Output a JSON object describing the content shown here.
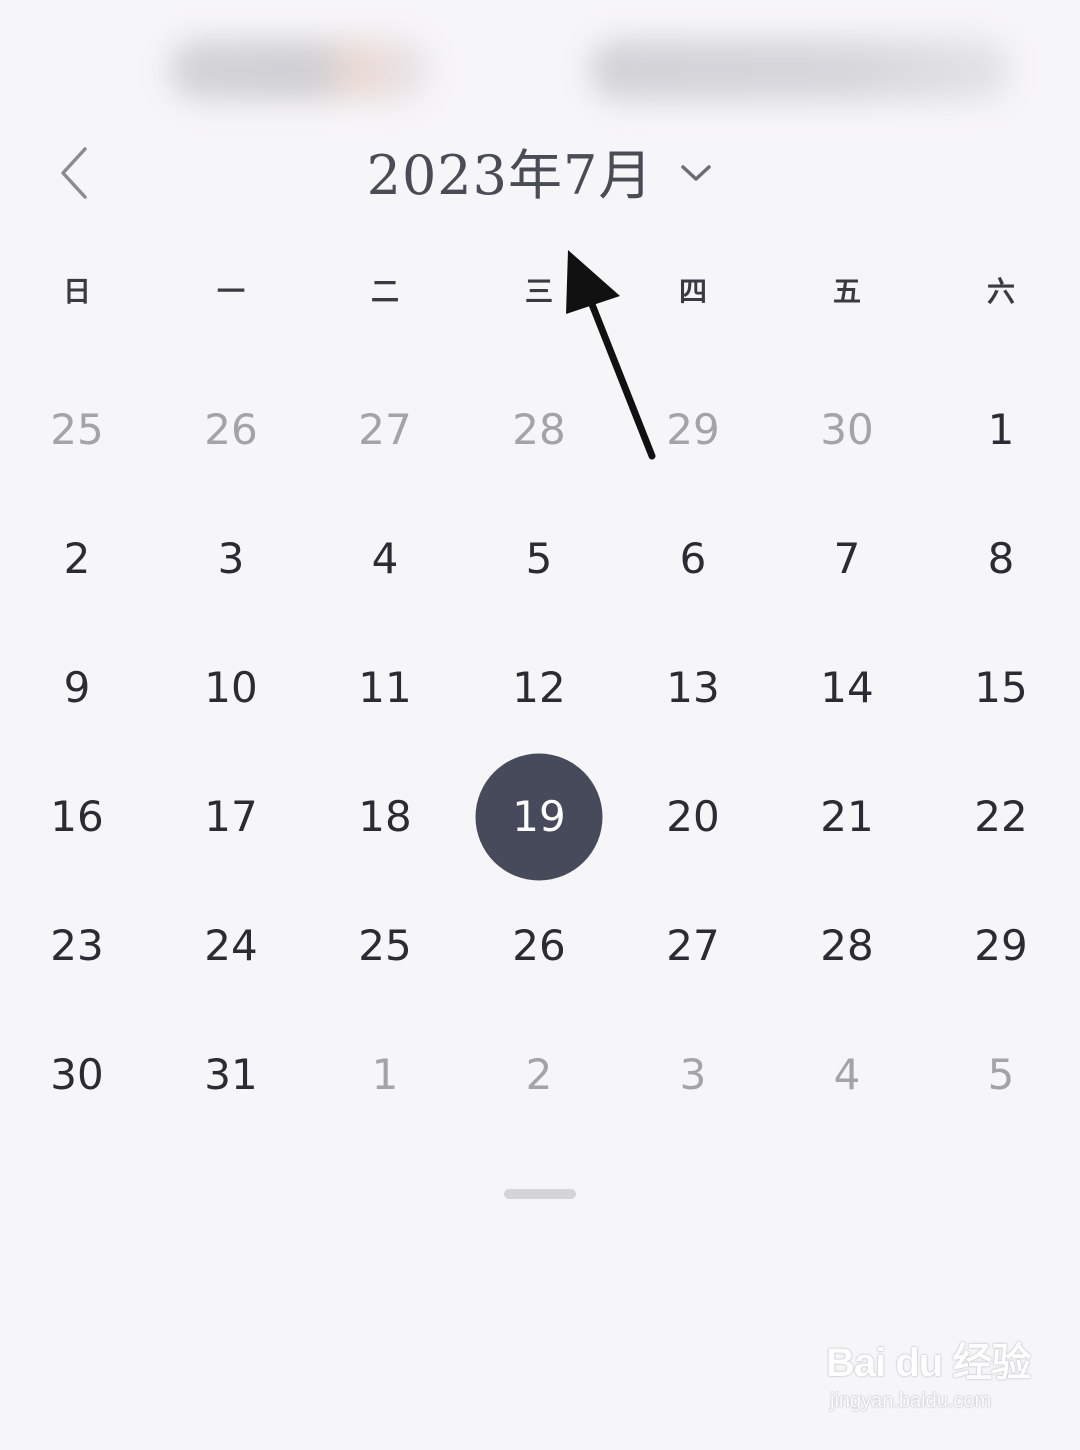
{
  "header": {
    "title": "2023年7月"
  },
  "weekdays": [
    "日",
    "一",
    "二",
    "三",
    "四",
    "五",
    "六"
  ],
  "calendar": {
    "weeks": [
      [
        {
          "d": "25",
          "o": true
        },
        {
          "d": "26",
          "o": true
        },
        {
          "d": "27",
          "o": true
        },
        {
          "d": "28",
          "o": true
        },
        {
          "d": "29",
          "o": true
        },
        {
          "d": "30",
          "o": true
        },
        {
          "d": "1",
          "o": false
        }
      ],
      [
        {
          "d": "2",
          "o": false
        },
        {
          "d": "3",
          "o": false
        },
        {
          "d": "4",
          "o": false
        },
        {
          "d": "5",
          "o": false
        },
        {
          "d": "6",
          "o": false
        },
        {
          "d": "7",
          "o": false
        },
        {
          "d": "8",
          "o": false
        }
      ],
      [
        {
          "d": "9",
          "o": false
        },
        {
          "d": "10",
          "o": false
        },
        {
          "d": "11",
          "o": false
        },
        {
          "d": "12",
          "o": false
        },
        {
          "d": "13",
          "o": false
        },
        {
          "d": "14",
          "o": false
        },
        {
          "d": "15",
          "o": false
        }
      ],
      [
        {
          "d": "16",
          "o": false
        },
        {
          "d": "17",
          "o": false
        },
        {
          "d": "18",
          "o": false
        },
        {
          "d": "19",
          "o": false,
          "selected": true
        },
        {
          "d": "20",
          "o": false
        },
        {
          "d": "21",
          "o": false
        },
        {
          "d": "22",
          "o": false
        }
      ],
      [
        {
          "d": "23",
          "o": false
        },
        {
          "d": "24",
          "o": false
        },
        {
          "d": "25",
          "o": false
        },
        {
          "d": "26",
          "o": false
        },
        {
          "d": "27",
          "o": false
        },
        {
          "d": "28",
          "o": false
        },
        {
          "d": "29",
          "o": false
        }
      ],
      [
        {
          "d": "30",
          "o": false
        },
        {
          "d": "31",
          "o": false
        },
        {
          "d": "1",
          "o": true
        },
        {
          "d": "2",
          "o": true
        },
        {
          "d": "3",
          "o": true
        },
        {
          "d": "4",
          "o": true
        },
        {
          "d": "5",
          "o": true
        }
      ]
    ]
  },
  "watermark": {
    "brand": "Bai du 经验",
    "url": "jingyan.baidu.com"
  },
  "icons": {
    "back": "chevron-left-icon",
    "dropdown": "chevron-down-icon",
    "annotation": "arrow-icon"
  },
  "colors": {
    "background": "#f6f5f8",
    "selected": "#474a5b",
    "text": "#2b2c33",
    "muted": "#a3a3a8"
  }
}
